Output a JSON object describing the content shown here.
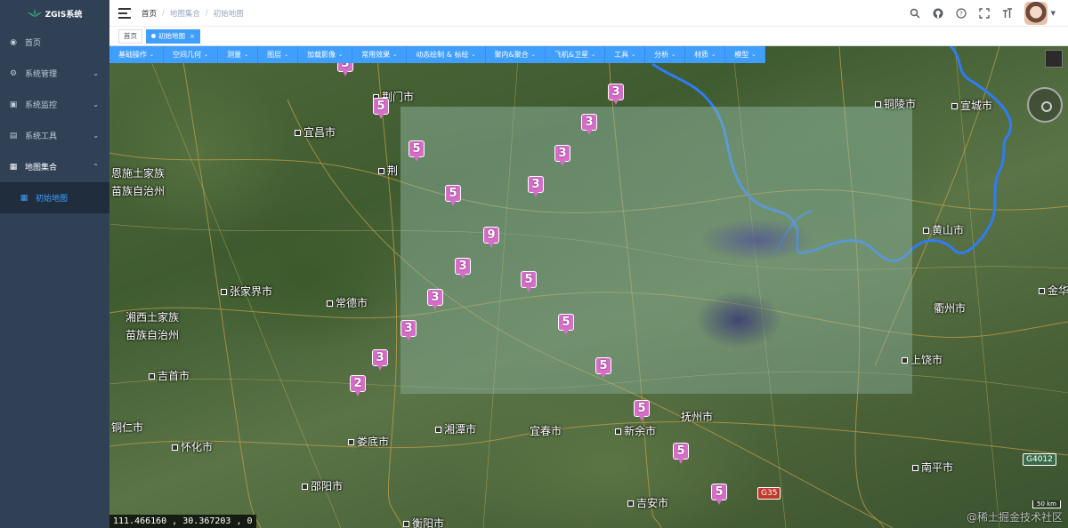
{
  "app": {
    "name": "ZGIS系统"
  },
  "sidebar": {
    "items": [
      {
        "label": "首页",
        "icon": "dashboard-icon"
      },
      {
        "label": "系统管理",
        "icon": "gear-icon"
      },
      {
        "label": "系统监控",
        "icon": "monitor-icon"
      },
      {
        "label": "系统工具",
        "icon": "toolbox-icon"
      },
      {
        "label": "地图集合",
        "icon": "map-icon"
      }
    ],
    "subitem": {
      "label": "初始地图",
      "icon": "grid-icon"
    }
  },
  "header": {
    "breadcrumb": [
      "首页",
      "地图集合",
      "初始地图"
    ],
    "tools": [
      "search-icon",
      "github-icon",
      "help-icon",
      "fullscreen-icon",
      "font-size-icon"
    ]
  },
  "tags": {
    "home": "首页",
    "active": "初始地图"
  },
  "toolbar": {
    "items": [
      "基础操作",
      "空间几何",
      "测量",
      "图层",
      "加载影像",
      "常用效果",
      "动态绘制 & 标绘",
      "聚内&聚合",
      "飞机&卫星",
      "工具",
      "分析",
      "材质",
      "模型"
    ]
  },
  "map": {
    "cities": [
      {
        "name": "荆门市"
      },
      {
        "name": "宜昌市"
      },
      {
        "name": "荆"
      },
      {
        "name": "恩施土家族"
      },
      {
        "name": "苗族自治州"
      },
      {
        "name": "张家界市"
      },
      {
        "name": "常德市"
      },
      {
        "name": "湘西土家族"
      },
      {
        "name": "苗族自治州"
      },
      {
        "name": "吉首市"
      },
      {
        "name": "铜仁市"
      },
      {
        "name": "怀化市"
      },
      {
        "name": "娄底市"
      },
      {
        "name": "湘潭市"
      },
      {
        "name": "宜春市"
      },
      {
        "name": "新余市"
      },
      {
        "name": "抚州市"
      },
      {
        "name": "邵阳市"
      },
      {
        "name": "衡阳市"
      },
      {
        "name": "吉安市"
      },
      {
        "name": "铜陵市"
      },
      {
        "name": "宣城市"
      },
      {
        "name": "黄山市"
      },
      {
        "name": "衢州市"
      },
      {
        "name": "上饶市"
      },
      {
        "name": "南平市"
      },
      {
        "name": "金华"
      }
    ],
    "markers": [
      "3",
      "3",
      "5",
      "3",
      "5",
      "3",
      "3",
      "5",
      "9",
      "3",
      "5",
      "3",
      "5",
      "3",
      "3",
      "5",
      "2",
      "5",
      "5",
      "5"
    ],
    "road_shields": [
      "G35",
      "G4012"
    ],
    "coordinates": "111.466160 ,  30.367203 ,  0",
    "scale": "50 km",
    "watermark": "@稀土掘金技术社区"
  },
  "colors": {
    "sidebar": "#304156",
    "accent": "#409eff",
    "marker": "#d66ec8",
    "river": "#2f7cf6"
  }
}
